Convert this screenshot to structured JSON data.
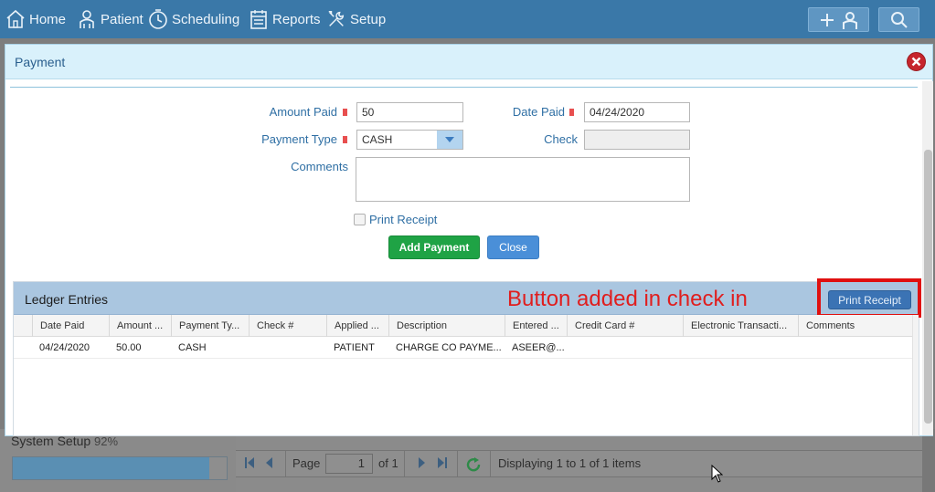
{
  "nav": {
    "items": [
      {
        "label": "Home",
        "icon": "home-icon"
      },
      {
        "label": "Patient",
        "icon": "patient-icon"
      },
      {
        "label": "Scheduling",
        "icon": "clock-icon"
      },
      {
        "label": "Reports",
        "icon": "calendar-icon"
      },
      {
        "label": "Setup",
        "icon": "tools-icon"
      }
    ],
    "add_patient_icon": "add-patient-icon",
    "search_icon": "search-icon"
  },
  "background": {
    "system_setup_label": "System Setup",
    "system_setup_pct": "92%",
    "progress_value": 0.92,
    "pager": {
      "page_label": "Page",
      "page_value": "1",
      "of_label": "of 1",
      "display_text": "Displaying 1 to 1 of 1 items"
    }
  },
  "modal": {
    "title": "Payment",
    "form": {
      "amount_paid_label": "Amount Paid",
      "amount_paid_value": "50",
      "date_paid_label": "Date Paid",
      "date_paid_value": "04/24/2020",
      "payment_type_label": "Payment Type",
      "payment_type_value": "CASH",
      "check_label": "Check",
      "check_value": "",
      "comments_label": "Comments",
      "comments_value": "",
      "print_receipt_label": "Print Receipt"
    },
    "buttons": {
      "add_payment": "Add Payment",
      "close": "Close"
    },
    "ledger": {
      "title": "Ledger Entries",
      "annotation": "Button added in check in",
      "print_receipt_button": "Print Receipt",
      "columns": [
        "Date Paid",
        "Amount ...",
        "Payment Ty...",
        "Check #",
        "Applied ...",
        "Description",
        "Entered ...",
        "Credit Card #",
        "Electronic Transacti...",
        "Comments"
      ],
      "rows": [
        [
          "04/24/2020",
          "50.00",
          "CASH",
          "",
          "PATIENT",
          "CHARGE CO PAYME...",
          "ASEER@...",
          "",
          "",
          ""
        ]
      ]
    }
  },
  "colors": {
    "nav_bg": "#3a78a8",
    "modal_header_bg": "#d9f1fb",
    "ledger_header_bg": "#aac6e0",
    "add_payment_green": "#1fa345",
    "close_blue": "#4a8fd8",
    "annotation_red": "#e01e1e",
    "required_marker": "#e84f4f"
  }
}
